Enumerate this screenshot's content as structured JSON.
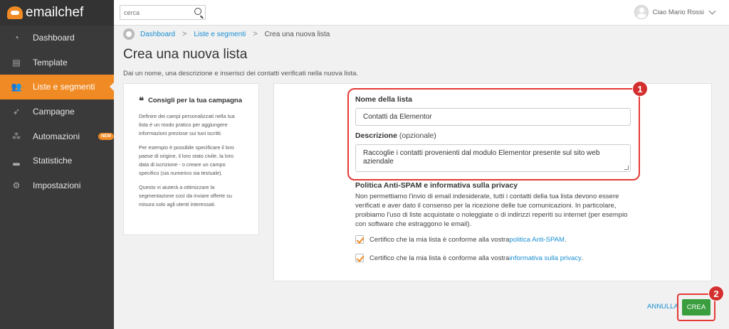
{
  "app": {
    "logo_text": "emailchef"
  },
  "sidebar": {
    "items": [
      {
        "label": "Dashboard",
        "icon": "dashboard-icon",
        "glyph": "◔"
      },
      {
        "label": "Template",
        "icon": "template-icon",
        "glyph": "▤"
      },
      {
        "label": "Liste e segmenti",
        "icon": "users-icon",
        "glyph": "👥",
        "active": true
      },
      {
        "label": "Campagne",
        "icon": "send-icon",
        "glyph": "➶"
      },
      {
        "label": "Automazioni",
        "icon": "automation-icon",
        "glyph": "⁂",
        "badge": "NEW"
      },
      {
        "label": "Statistiche",
        "icon": "stats-icon",
        "glyph": "▂"
      },
      {
        "label": "Impostazioni",
        "icon": "settings-icon",
        "glyph": "⚙"
      }
    ]
  },
  "topbar": {
    "search_placeholder": "cerca",
    "user_greeting": "Ciao Mario Rossi"
  },
  "breadcrumb": {
    "items": [
      "Dashboard",
      "Liste e segmenti",
      "Crea una nuova lista"
    ]
  },
  "page": {
    "title": "Crea una nuova lista",
    "subtitle": "Dai un nome, una descrizione e inserisci dei contatti verificati nella nuova lista."
  },
  "tips": {
    "title": "Consigli per la tua campagna",
    "paragraphs": [
      "Definire dei campi personalizzati nella tua lista è un modo pratico per aggiungere informazioni preziose sui tuoi iscritti.",
      "Per esempio è possibile specificare il loro paese di origine, il loro stato civile, la loro data di iscrizione - o creare un campo specifico (sia numerico sia testuale).",
      "Questo vi aiuterà a ottimizzare la segmentazione così da inviare offerte su misura solo agli utenti interessati."
    ]
  },
  "form": {
    "name_label": "Nome della lista",
    "name_value": "Contatti da Elementor",
    "desc_label": "Descrizione",
    "desc_optional": "(opzionale)",
    "desc_value": "Raccoglie i contatti provenienti dal modulo Elementor presente sul sito web aziendale",
    "policy_title": "Politica Anti-SPAM e informativa sulla privacy",
    "policy_text": "Non permettiamo l'invio di email indesiderate, tutti i contatti della tua lista devono essere verificati e aver dato il consenso per la ricezione delle tue comunicazioni. In particolare, proibiamo l'uso di liste acquistate o noleggiate o di indirizzi reperiti su internet (per esempio con software che estraggono le email).",
    "check1_text": "Certifico che la mia lista è conforme alla vostra ",
    "check1_link": "politica Anti-SPAM",
    "check2_text": "Certifico che la mia lista è conforme alla vostra ",
    "check2_link": "informativa sulla privacy",
    "period": "."
  },
  "actions": {
    "cancel": "ANNULLA",
    "create": "CREA"
  },
  "annotations": {
    "badge1": "1",
    "badge2": "2"
  },
  "colors": {
    "accent": "#f08a24",
    "link": "#1a8fd2",
    "create": "#3a9e3f",
    "highlight": "#e53935"
  }
}
